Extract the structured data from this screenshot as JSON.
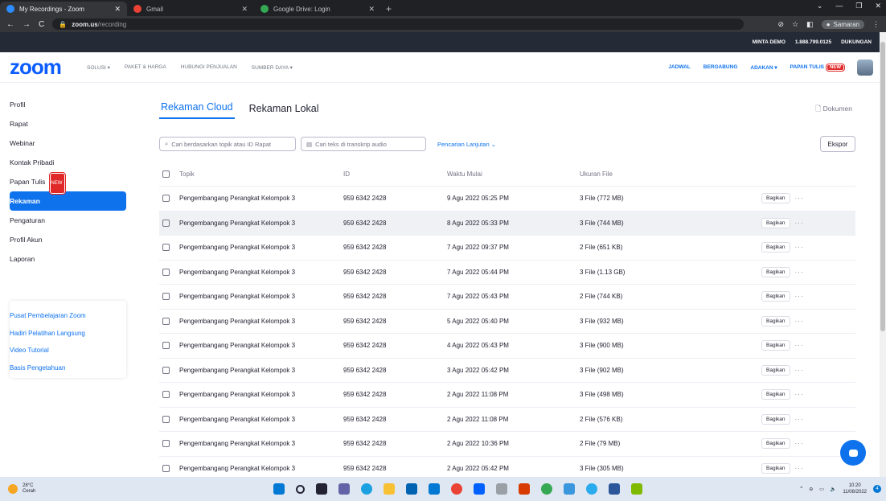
{
  "browser": {
    "tabs": [
      {
        "label": "My Recordings - Zoom",
        "color": "#2d8cff"
      },
      {
        "label": "Gmail",
        "color": "#ea4335"
      },
      {
        "label": "Google Drive: Login",
        "color": "#34a853"
      }
    ],
    "url_host": "zoom.us",
    "url_path": "/recording",
    "profile": "Samaran"
  },
  "top_strip": {
    "demo": "MINTA DEMO",
    "phone": "1.888.799.0125",
    "support": "DUKUNGAN"
  },
  "nav": {
    "logo": "zoom",
    "items": [
      "SOLUSI ▾",
      "PAKET & HARGA",
      "HUBUNGI PENJUALAN",
      "SUMBER DAYA ▾"
    ],
    "right": {
      "schedule": "JADWAL",
      "join": "BERGABUNG",
      "host": "ADAKAN ▾",
      "whiteboard": "PAPAN TULIS",
      "new_badge": "NEW"
    }
  },
  "sidebar": {
    "items": [
      "Profil",
      "Rapat",
      "Webinar",
      "Kontak Pribadi",
      "Papan Tulis",
      "Rekaman",
      "Pengaturan",
      "Profil Akun",
      "Laporan"
    ],
    "new_badge": "NEW",
    "learn": [
      "Pusat Pembelajaran Zoom",
      "Hadiri Pelatihan Langsung",
      "Video Tutorial",
      "Basis Pengetahuan"
    ]
  },
  "main": {
    "tabs": [
      "Rekaman Cloud",
      "Rekaman Lokal"
    ],
    "docs": "Dokumen",
    "search_topic_placeholder": "Cari berdasarkan topik atau ID Rapat",
    "search_transcript_placeholder": "Cari teks di transkrip audio",
    "advanced": "Pencarian Lanjutan ⌄",
    "export": "Ekspor",
    "headers": [
      "Topik",
      "ID",
      "Waktu Mulai",
      "Ukuran File"
    ],
    "share_label": "Bagikan",
    "more_label": "···",
    "rows": [
      {
        "topic": "Pengembangang Perangkat Kelompok 3",
        "id": "959 6342 2428",
        "time": "9 Agu 2022 05:25 PM",
        "size": "3 File (772 MB)"
      },
      {
        "topic": "Pengembangang Perangkat Kelompok 3",
        "id": "959 6342 2428",
        "time": "8 Agu 2022 05:33 PM",
        "size": "3 File (744 MB)"
      },
      {
        "topic": "Pengembangang Perangkat Kelompok 3",
        "id": "959 6342 2428",
        "time": "7 Agu 2022 09:37 PM",
        "size": "2 File (651 KB)"
      },
      {
        "topic": "Pengembangang Perangkat Kelompok 3",
        "id": "959 6342 2428",
        "time": "7 Agu 2022 05:44 PM",
        "size": "3 File (1.13 GB)"
      },
      {
        "topic": "Pengembangang Perangkat Kelompok 3",
        "id": "959 6342 2428",
        "time": "7 Agu 2022 05:43 PM",
        "size": "2 File (744 KB)"
      },
      {
        "topic": "Pengembangang Perangkat Kelompok 3",
        "id": "959 6342 2428",
        "time": "5 Agu 2022 05:40 PM",
        "size": "3 File (932 MB)"
      },
      {
        "topic": "Pengembangang Perangkat Kelompok 3",
        "id": "959 6342 2428",
        "time": "4 Agu 2022 05:43 PM",
        "size": "3 File (900 MB)"
      },
      {
        "topic": "Pengembangang Perangkat Kelompok 3",
        "id": "959 6342 2428",
        "time": "3 Agu 2022 05:42 PM",
        "size": "3 File (902 MB)"
      },
      {
        "topic": "Pengembangang Perangkat Kelompok 3",
        "id": "959 6342 2428",
        "time": "2 Agu 2022 11:08 PM",
        "size": "3 File (498 MB)"
      },
      {
        "topic": "Pengembangang Perangkat Kelompok 3",
        "id": "959 6342 2428",
        "time": "2 Agu 2022 11:08 PM",
        "size": "2 File (576 KB)"
      },
      {
        "topic": "Pengembangang Perangkat Kelompok 3",
        "id": "959 6342 2428",
        "time": "2 Agu 2022 10:36 PM",
        "size": "2 File (79 MB)"
      },
      {
        "topic": "Pengembangang Perangkat Kelompok 3",
        "id": "959 6342 2428",
        "time": "2 Agu 2022 05:42 PM",
        "size": "3 File (305 MB)"
      }
    ]
  },
  "taskbar": {
    "temp": "28°C",
    "weather": "Cerah",
    "time": "10:20",
    "date": "11/08/2022",
    "notif_count": "4"
  }
}
